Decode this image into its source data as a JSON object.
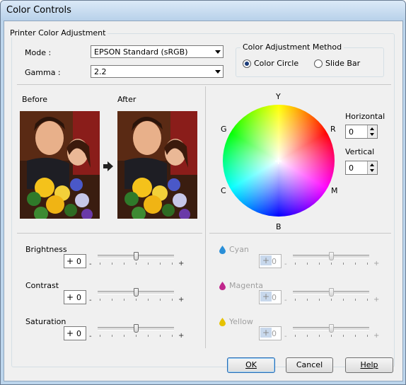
{
  "window": {
    "title": "Color Controls"
  },
  "printer_group": {
    "label": "Printer Color Adjustment"
  },
  "mode": {
    "label": "Mode :",
    "value": "EPSON Standard (sRGB)"
  },
  "gamma": {
    "label": "Gamma :",
    "value": "2.2"
  },
  "method": {
    "label": "Color Adjustment Method",
    "options": [
      {
        "label": "Color Circle",
        "checked": true
      },
      {
        "label": "Slide Bar",
        "checked": false
      }
    ]
  },
  "preview": {
    "before_label": "Before",
    "after_label": "After"
  },
  "circle": {
    "y": "Y",
    "r": "R",
    "g": "G",
    "c": "C",
    "m": "M",
    "b": "B"
  },
  "horizontal": {
    "label": "Horizontal",
    "value": "0"
  },
  "vertical": {
    "label": "Vertical",
    "value": "0"
  },
  "sliders_left": [
    {
      "label": "Brightness",
      "sign": "+",
      "value": "0",
      "level": 0.5
    },
    {
      "label": "Contrast",
      "sign": "+",
      "value": "0",
      "level": 0.5
    },
    {
      "label": "Saturation",
      "sign": "+",
      "value": "0",
      "level": 0.5
    }
  ],
  "sliders_right": [
    {
      "label": "Cyan",
      "sign": "+",
      "value": "0",
      "color": "#2a8fd8",
      "level": 0.5
    },
    {
      "label": "Magenta",
      "sign": "+",
      "value": "0",
      "color": "#c0268c",
      "level": 0.5
    },
    {
      "label": "Yellow",
      "sign": "+",
      "value": "0",
      "color": "#e6c200",
      "level": 0.5
    }
  ],
  "slider_ends": {
    "minus": "-",
    "plus": "+"
  },
  "buttons": {
    "ok": "OK",
    "cancel": "Cancel",
    "help": "Help"
  }
}
